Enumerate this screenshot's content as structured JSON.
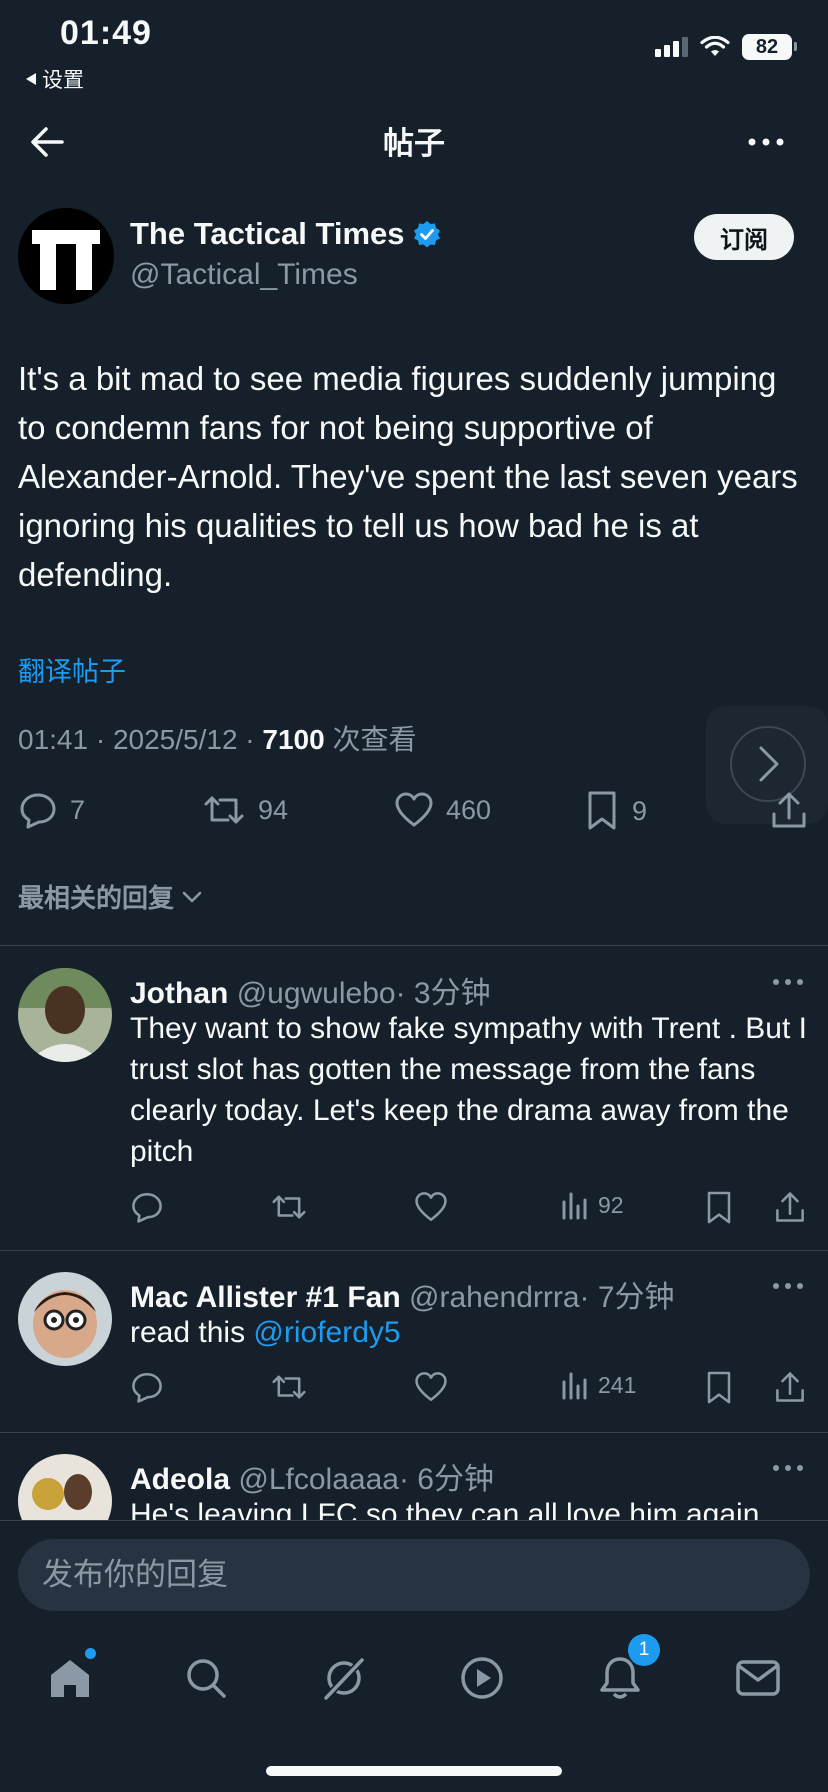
{
  "status_bar": {
    "time": "01:49",
    "back_app": "设置",
    "battery": "82"
  },
  "nav": {
    "title": "帖子"
  },
  "author": {
    "name": "The Tactical Times",
    "handle": "@Tactical_Times",
    "subscribe_label": "订阅"
  },
  "tweet": {
    "text": "It's a bit mad to see media figures suddenly jumping to condemn fans for not being supportive of Alexander-Arnold. They've spent the last seven years ignoring his qualities to tell us how bad he is at defending.",
    "translate_label": "翻译帖子",
    "timestamp": "01:41 · 2025/5/12 · ",
    "views": "7100",
    "views_suffix": " 次查看",
    "replies": "7",
    "retweets": "94",
    "likes": "460",
    "bookmarks": "9"
  },
  "sort_label": "最相关的回复",
  "replies": [
    {
      "name": "Jothan",
      "handle": "@ugwulebo",
      "time": "· 3分钟",
      "text": "They want to show fake sympathy with Trent . But I trust slot has gotten the message from the fans clearly today. Let's keep the drama away from the pitch",
      "views": "92"
    },
    {
      "name": "Mac Allister #1 Fan",
      "handle": "@rahendrrra",
      "time": "· 7分钟",
      "text": "read this ",
      "mention": "@rioferdy5",
      "views": "241"
    },
    {
      "name": "Adeola",
      "handle": "@Lfcolaaaa",
      "time": "· 6分钟",
      "text": "He's leaving LFC so they can all love him again"
    }
  ],
  "reply_box": {
    "placeholder": "发布你的回复"
  },
  "tabbar": {
    "notifications_badge": "1"
  },
  "colors": {
    "background": "#15202b",
    "accent": "#1d9bf0",
    "muted": "#8b98a5",
    "divider": "#38444d"
  }
}
